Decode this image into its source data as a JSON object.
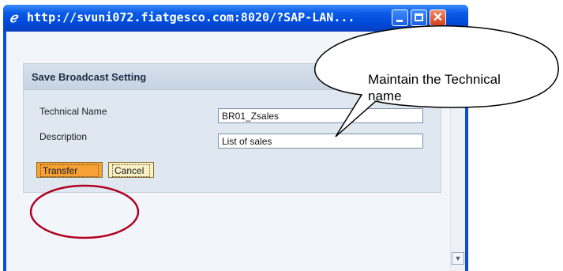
{
  "window": {
    "title": "http://svuni072.fiatgesco.com:8020/?SAP-LAN...",
    "icon": "ie-e-icon"
  },
  "dialog": {
    "title": "Save Broadcast Setting",
    "technical_name_label": "Technical Name",
    "technical_name_value": "BR01_Zsales",
    "description_label": "Description",
    "description_value": "List of sales",
    "transfer_label": "Transfer",
    "cancel_label": "Cancel"
  },
  "callout": {
    "text": "Maintain the Technical name"
  },
  "colors": {
    "titlebar": "#0b5ce6",
    "transfer_button": "#f7a035",
    "cancel_button": "#f8f1c6",
    "annotation_circle": "#b00020"
  }
}
